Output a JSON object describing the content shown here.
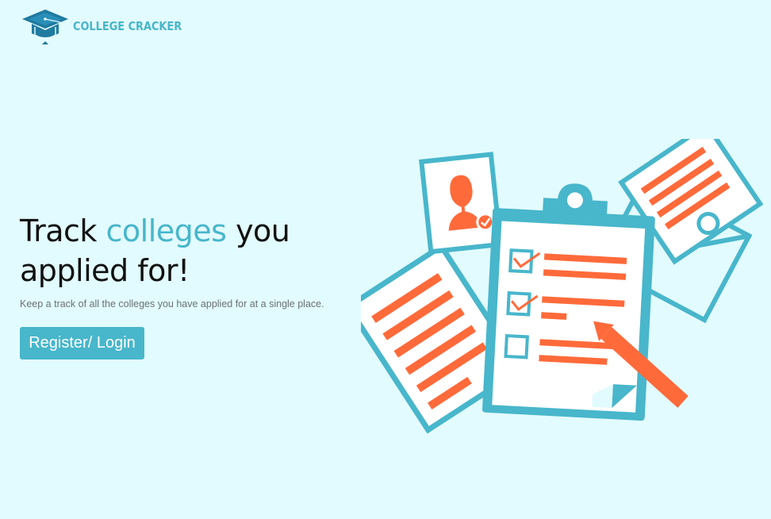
{
  "brand": {
    "name": "COLLEGE CRACKER",
    "logo_icon": "graduation-cap-icon"
  },
  "hero": {
    "title_part1": "Track",
    "title_accent": "colleges",
    "title_part2": "you",
    "title_line2": "applied for!",
    "subtitle": "Keep a track of all the colleges you have applied for at a single place.",
    "cta_label": "Register/ Login"
  },
  "colors": {
    "background": "#e2fbfe",
    "accent": "#48b6cb",
    "illustration_orange": "#ff6a3a",
    "title": "#111111"
  },
  "illustration": {
    "icon": "application-checklist-illustration"
  }
}
